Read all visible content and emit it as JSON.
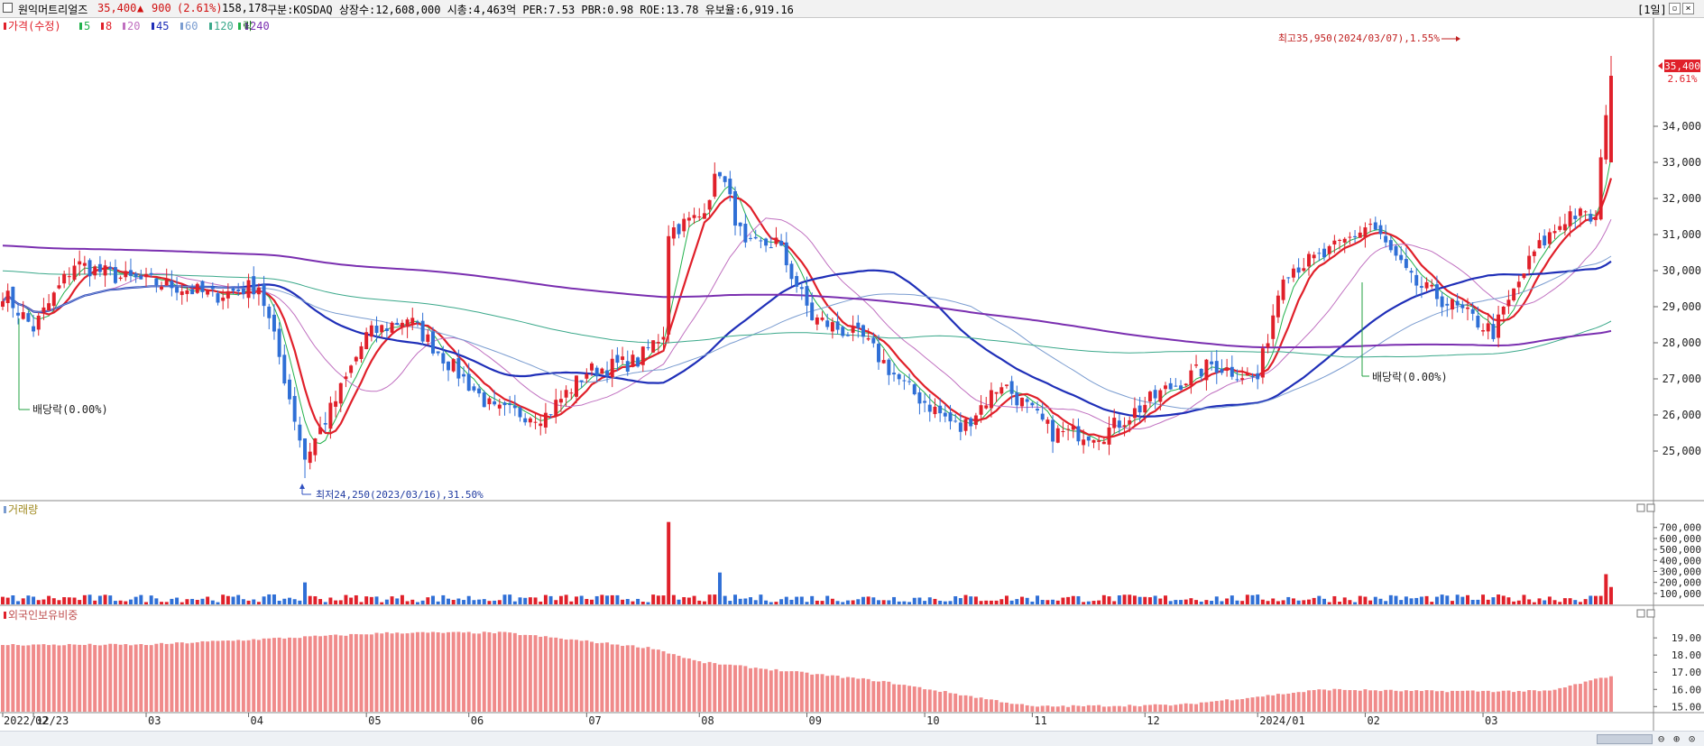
{
  "header": {
    "stock_name": "원익머트리얼즈",
    "price": "35,400",
    "arrow": "▲",
    "change": "900",
    "change_pct": "(2.61%)",
    "volume": "158,178",
    "info": "구분:KOSDAQ 상장수:12,608,000 시총:4,463억 PER:7.53 PBR:0.98 ROE:13.78 유보율:6,919.16",
    "period_button": "[1일]"
  },
  "legend": {
    "price_label": "가격(수정)",
    "ma_labels": [
      "5",
      "8",
      "20",
      "45",
      "60",
      "120",
      "240"
    ],
    "ma_colors": [
      "#22b14c",
      "#e0202a",
      "#c070c0",
      "#1f2fb8",
      "#7a9cd0",
      "#3aa88a",
      "#7a2fb0"
    ],
    "drop_label": "락"
  },
  "colors": {
    "up": "#e0202a",
    "down": "#2f6fd6",
    "foreign_bar": "#f08a8a",
    "price_tag": "#e0202a"
  },
  "annotations": {
    "high": "최고35,950(2024/03/07),1.55%",
    "low": "최저24,250(2023/03/16),31.50%",
    "dividend1": "배당락(0.00%)",
    "dividend2": "배당락(0.00%)"
  },
  "price_tag": {
    "value": "35,400",
    "pct": "2.61%"
  },
  "volume_panel": {
    "label": "거래량"
  },
  "foreign_panel": {
    "label": "외국인보유비중"
  },
  "x_axis": {
    "labels": [
      "2022/12/23",
      "02",
      "03",
      "04",
      "05",
      "06",
      "07",
      "08",
      "09",
      "10",
      "11",
      "12",
      "2024/01",
      "02",
      "03"
    ]
  },
  "chart_data": [
    {
      "type": "candlestick",
      "title": "",
      "y_ticks": [
        25000,
        26000,
        27000,
        28000,
        29000,
        30000,
        31000,
        32000,
        33000,
        34000
      ],
      "y_tick_labels": [
        "25,000",
        "26,000",
        "27,000",
        "28,000",
        "29,000",
        "30,000",
        "31,000",
        "32,000",
        "33,000",
        "34,000"
      ],
      "ylim": [
        24000,
        36500
      ],
      "close_anchors": [
        {
          "date": "2022-12-23",
          "close": 29400
        },
        {
          "date": "2023-01-02",
          "close": 28400
        },
        {
          "date": "2023-01-12",
          "close": 30200
        },
        {
          "date": "2023-01-25",
          "close": 29800
        },
        {
          "date": "2023-02-08",
          "close": 29600
        },
        {
          "date": "2023-02-20",
          "close": 29300
        },
        {
          "date": "2023-03-03",
          "close": 29600
        },
        {
          "date": "2023-03-09",
          "close": 27600
        },
        {
          "date": "2023-03-16",
          "close": 24800
        },
        {
          "date": "2023-03-24",
          "close": 26400
        },
        {
          "date": "2023-04-03",
          "close": 28200
        },
        {
          "date": "2023-04-13",
          "close": 28700
        },
        {
          "date": "2023-04-24",
          "close": 27600
        },
        {
          "date": "2023-05-08",
          "close": 26100
        },
        {
          "date": "2023-05-22",
          "close": 26000
        },
        {
          "date": "2023-06-01",
          "close": 27200
        },
        {
          "date": "2023-06-15",
          "close": 27500
        },
        {
          "date": "2023-06-22",
          "close": 28300
        },
        {
          "date": "2023-06-23",
          "close": 31100
        },
        {
          "date": "2023-07-03",
          "close": 31500
        },
        {
          "date": "2023-07-07",
          "close": 32800
        },
        {
          "date": "2023-07-14",
          "close": 30600
        },
        {
          "date": "2023-07-24",
          "close": 30800
        },
        {
          "date": "2023-08-02",
          "close": 28700
        },
        {
          "date": "2023-08-16",
          "close": 28100
        },
        {
          "date": "2023-08-28",
          "close": 26800
        },
        {
          "date": "2023-09-12",
          "close": 25600
        },
        {
          "date": "2023-09-22",
          "close": 26900
        },
        {
          "date": "2023-10-06",
          "close": 25500
        },
        {
          "date": "2023-10-20",
          "close": 25500
        },
        {
          "date": "2023-11-06",
          "close": 26600
        },
        {
          "date": "2023-11-20",
          "close": 27400
        },
        {
          "date": "2023-12-01",
          "close": 27000
        },
        {
          "date": "2023-12-08",
          "close": 30000
        },
        {
          "date": "2023-12-20",
          "close": 30400
        },
        {
          "date": "2024-01-02",
          "close": 31300
        },
        {
          "date": "2024-01-12",
          "close": 29700
        },
        {
          "date": "2024-01-22",
          "close": 29200
        },
        {
          "date": "2024-02-05",
          "close": 28300
        },
        {
          "date": "2024-02-15",
          "close": 30500
        },
        {
          "date": "2024-02-26",
          "close": 31600
        },
        {
          "date": "2024-03-04",
          "close": 31400
        },
        {
          "date": "2024-03-06",
          "close": 34500
        },
        {
          "date": "2024-03-07",
          "close": 35400
        }
      ],
      "high": {
        "date": "2024-03-07",
        "value": 35950
      },
      "low": {
        "date": "2023-03-16",
        "value": 24250
      },
      "moving_averages": [
        5,
        8,
        20,
        45,
        60,
        120,
        240
      ]
    },
    {
      "type": "bar",
      "title": "거래량",
      "y_tick_labels": [
        "700,000",
        "600,000",
        "500,000",
        "400,000",
        "300,000",
        "200,000",
        "100,000"
      ],
      "ylim": [
        0,
        780000
      ],
      "typical_volume": 55000,
      "spikes": [
        {
          "date": "2023-06-23",
          "value": 750000
        },
        {
          "date": "2023-07-07",
          "value": 290000
        },
        {
          "date": "2023-03-16",
          "value": 200000
        },
        {
          "date": "2024-03-06",
          "value": 275000
        },
        {
          "date": "2024-03-07",
          "value": 158178
        }
      ]
    },
    {
      "type": "bar",
      "title": "외국인보유비중",
      "y_tick_labels": [
        "19.00",
        "18.00",
        "17.00",
        "16.00",
        "15.00"
      ],
      "ylim": [
        14.7,
        19.9
      ],
      "anchors": [
        {
          "date": "2022-12-23",
          "value": 18.6
        },
        {
          "date": "2023-02-01",
          "value": 18.6
        },
        {
          "date": "2023-04-10",
          "value": 19.3
        },
        {
          "date": "2023-05-10",
          "value": 19.3
        },
        {
          "date": "2023-06-20",
          "value": 18.4
        },
        {
          "date": "2023-07-03",
          "value": 17.6
        },
        {
          "date": "2023-08-20",
          "value": 16.5
        },
        {
          "date": "2023-10-01",
          "value": 15.0
        },
        {
          "date": "2023-11-10",
          "value": 15.1
        },
        {
          "date": "2023-12-20",
          "value": 16.0
        },
        {
          "date": "2024-01-15",
          "value": 15.9
        },
        {
          "date": "2024-02-20",
          "value": 15.9
        },
        {
          "date": "2024-03-07",
          "value": 16.8
        }
      ]
    }
  ]
}
